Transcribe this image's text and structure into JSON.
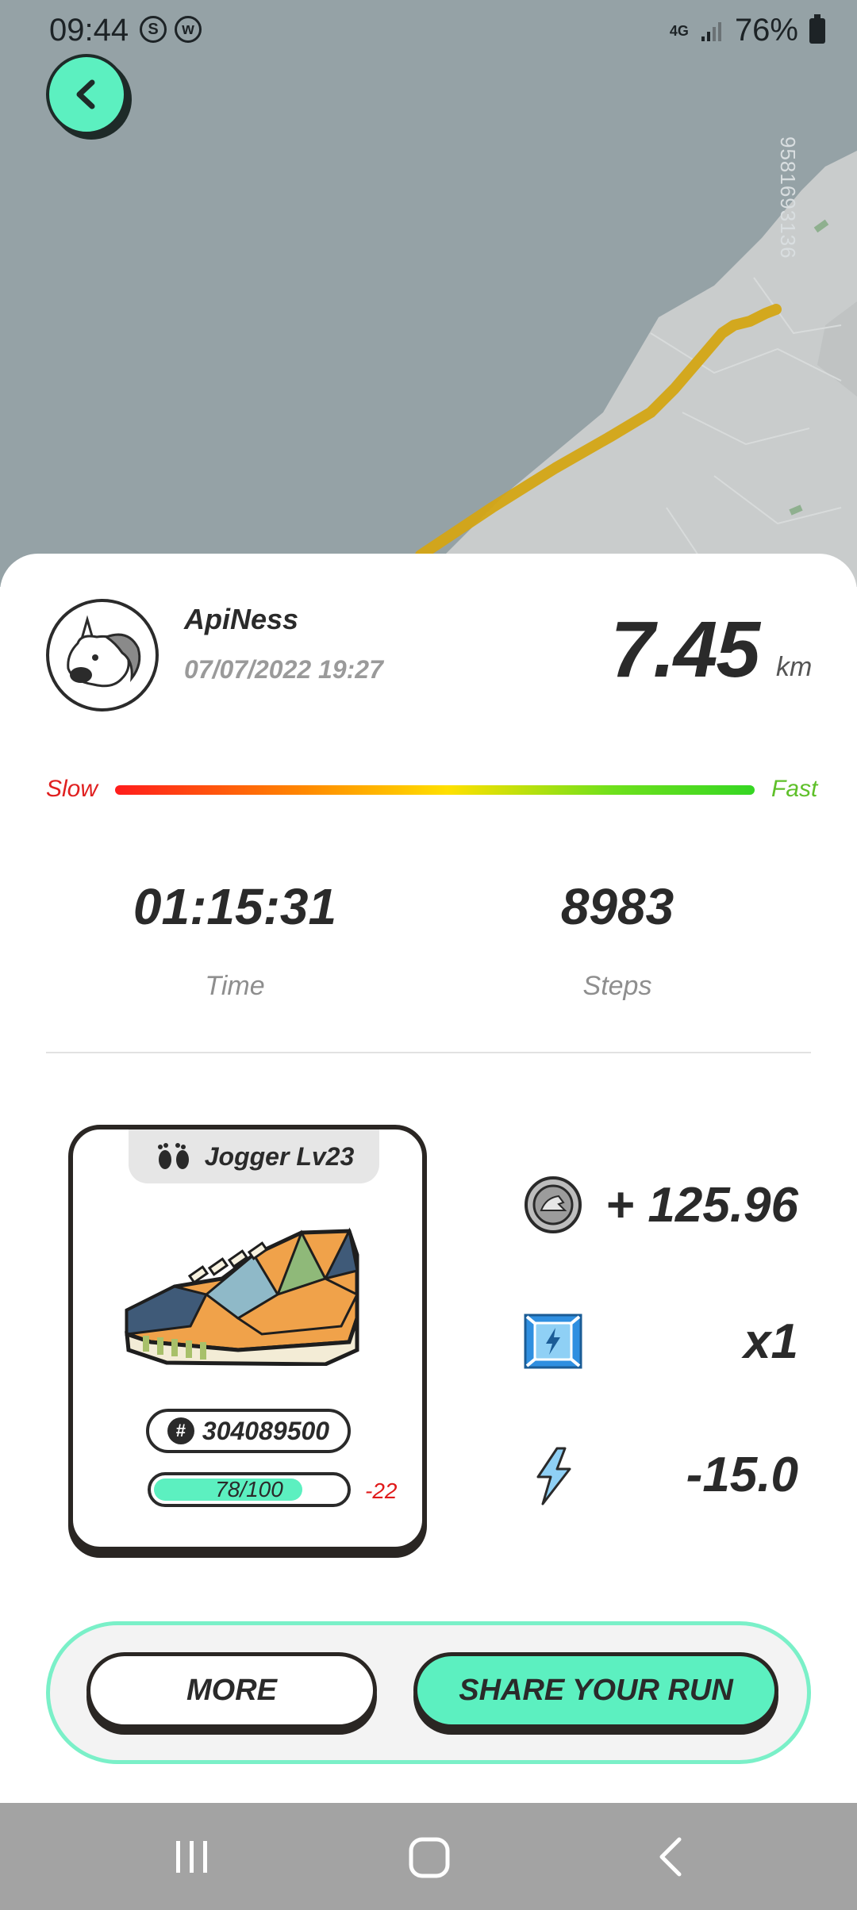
{
  "status_bar": {
    "time": "09:44",
    "notification_icons": [
      "skype-icon",
      "w-icon"
    ],
    "network": "4G",
    "battery_percent": "76%"
  },
  "map": {
    "overlay_id": "9581693136"
  },
  "run": {
    "user_name": "ApiNess",
    "date": "07/07/2022 19:27",
    "distance": "7.45",
    "distance_unit": "km",
    "speed_slow_label": "Slow",
    "speed_fast_label": "Fast",
    "time_value": "01:15:31",
    "time_label": "Time",
    "steps_value": "8983",
    "steps_label": "Steps"
  },
  "shoe": {
    "type_label": "Jogger Lv23",
    "id": "304089500",
    "durability_text": "78/100",
    "durability_fraction": 0.78,
    "durability_change": "-22"
  },
  "rewards": {
    "token": "+ 125.96",
    "multiplier": "x1",
    "energy": "-15.0"
  },
  "actions": {
    "more_label": "MORE",
    "share_label": "SHARE YOUR RUN"
  },
  "colors": {
    "accent": "#5cf0c0",
    "map_water": "#95a2a6",
    "route": "#d4a514",
    "speed_slow": "#e02020",
    "speed_fast": "#5fc02a"
  }
}
